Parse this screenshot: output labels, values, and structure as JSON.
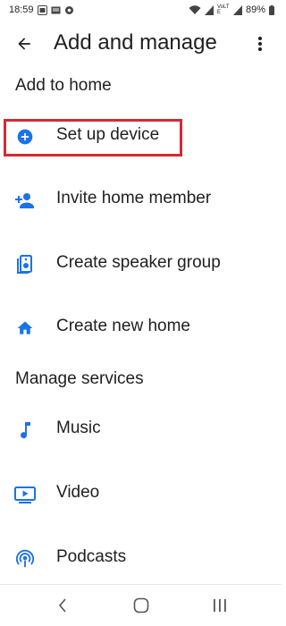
{
  "status_bar": {
    "time": "18:59",
    "battery_percent": "89%",
    "network_label": "VoLTE"
  },
  "app_bar": {
    "title": "Add and manage",
    "back_icon": "arrow-back-icon",
    "more_icon": "more-vert-icon"
  },
  "sections": {
    "add_to_home": {
      "heading": "Add to home",
      "items": [
        {
          "label": "Set up device",
          "icon": "add-circle-icon"
        },
        {
          "label": "Invite home member",
          "icon": "person-add-icon"
        },
        {
          "label": "Create speaker group",
          "icon": "speaker-icon"
        },
        {
          "label": "Create new home",
          "icon": "home-icon"
        }
      ]
    },
    "manage_services": {
      "heading": "Manage services",
      "items": [
        {
          "label": "Music",
          "icon": "music-note-icon"
        },
        {
          "label": "Video",
          "icon": "video-icon"
        },
        {
          "label": "Podcasts",
          "icon": "podcasts-icon"
        }
      ]
    }
  },
  "colors": {
    "accent": "#1a73e8",
    "highlight": "#d62832",
    "text": "#1f1f1f"
  },
  "nav_bar": {
    "back_icon": "nav-back-icon",
    "home_icon": "nav-home-icon",
    "recents_icon": "nav-recents-icon"
  }
}
